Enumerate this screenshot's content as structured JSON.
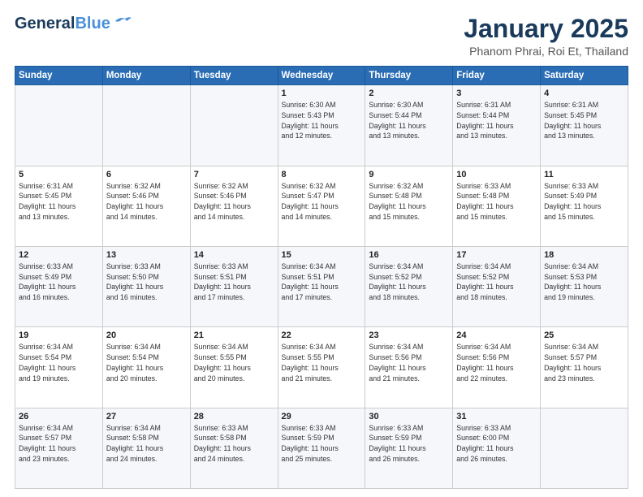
{
  "header": {
    "logo_general": "General",
    "logo_blue": "Blue",
    "month_title": "January 2025",
    "location": "Phanom Phrai, Roi Et, Thailand"
  },
  "days_of_week": [
    "Sunday",
    "Monday",
    "Tuesday",
    "Wednesday",
    "Thursday",
    "Friday",
    "Saturday"
  ],
  "weeks": [
    [
      {
        "day": "",
        "info": ""
      },
      {
        "day": "",
        "info": ""
      },
      {
        "day": "",
        "info": ""
      },
      {
        "day": "1",
        "info": "Sunrise: 6:30 AM\nSunset: 5:43 PM\nDaylight: 11 hours\nand 12 minutes."
      },
      {
        "day": "2",
        "info": "Sunrise: 6:30 AM\nSunset: 5:44 PM\nDaylight: 11 hours\nand 13 minutes."
      },
      {
        "day": "3",
        "info": "Sunrise: 6:31 AM\nSunset: 5:44 PM\nDaylight: 11 hours\nand 13 minutes."
      },
      {
        "day": "4",
        "info": "Sunrise: 6:31 AM\nSunset: 5:45 PM\nDaylight: 11 hours\nand 13 minutes."
      }
    ],
    [
      {
        "day": "5",
        "info": "Sunrise: 6:31 AM\nSunset: 5:45 PM\nDaylight: 11 hours\nand 13 minutes."
      },
      {
        "day": "6",
        "info": "Sunrise: 6:32 AM\nSunset: 5:46 PM\nDaylight: 11 hours\nand 14 minutes."
      },
      {
        "day": "7",
        "info": "Sunrise: 6:32 AM\nSunset: 5:46 PM\nDaylight: 11 hours\nand 14 minutes."
      },
      {
        "day": "8",
        "info": "Sunrise: 6:32 AM\nSunset: 5:47 PM\nDaylight: 11 hours\nand 14 minutes."
      },
      {
        "day": "9",
        "info": "Sunrise: 6:32 AM\nSunset: 5:48 PM\nDaylight: 11 hours\nand 15 minutes."
      },
      {
        "day": "10",
        "info": "Sunrise: 6:33 AM\nSunset: 5:48 PM\nDaylight: 11 hours\nand 15 minutes."
      },
      {
        "day": "11",
        "info": "Sunrise: 6:33 AM\nSunset: 5:49 PM\nDaylight: 11 hours\nand 15 minutes."
      }
    ],
    [
      {
        "day": "12",
        "info": "Sunrise: 6:33 AM\nSunset: 5:49 PM\nDaylight: 11 hours\nand 16 minutes."
      },
      {
        "day": "13",
        "info": "Sunrise: 6:33 AM\nSunset: 5:50 PM\nDaylight: 11 hours\nand 16 minutes."
      },
      {
        "day": "14",
        "info": "Sunrise: 6:33 AM\nSunset: 5:51 PM\nDaylight: 11 hours\nand 17 minutes."
      },
      {
        "day": "15",
        "info": "Sunrise: 6:34 AM\nSunset: 5:51 PM\nDaylight: 11 hours\nand 17 minutes."
      },
      {
        "day": "16",
        "info": "Sunrise: 6:34 AM\nSunset: 5:52 PM\nDaylight: 11 hours\nand 18 minutes."
      },
      {
        "day": "17",
        "info": "Sunrise: 6:34 AM\nSunset: 5:52 PM\nDaylight: 11 hours\nand 18 minutes."
      },
      {
        "day": "18",
        "info": "Sunrise: 6:34 AM\nSunset: 5:53 PM\nDaylight: 11 hours\nand 19 minutes."
      }
    ],
    [
      {
        "day": "19",
        "info": "Sunrise: 6:34 AM\nSunset: 5:54 PM\nDaylight: 11 hours\nand 19 minutes."
      },
      {
        "day": "20",
        "info": "Sunrise: 6:34 AM\nSunset: 5:54 PM\nDaylight: 11 hours\nand 20 minutes."
      },
      {
        "day": "21",
        "info": "Sunrise: 6:34 AM\nSunset: 5:55 PM\nDaylight: 11 hours\nand 20 minutes."
      },
      {
        "day": "22",
        "info": "Sunrise: 6:34 AM\nSunset: 5:55 PM\nDaylight: 11 hours\nand 21 minutes."
      },
      {
        "day": "23",
        "info": "Sunrise: 6:34 AM\nSunset: 5:56 PM\nDaylight: 11 hours\nand 21 minutes."
      },
      {
        "day": "24",
        "info": "Sunrise: 6:34 AM\nSunset: 5:56 PM\nDaylight: 11 hours\nand 22 minutes."
      },
      {
        "day": "25",
        "info": "Sunrise: 6:34 AM\nSunset: 5:57 PM\nDaylight: 11 hours\nand 23 minutes."
      }
    ],
    [
      {
        "day": "26",
        "info": "Sunrise: 6:34 AM\nSunset: 5:57 PM\nDaylight: 11 hours\nand 23 minutes."
      },
      {
        "day": "27",
        "info": "Sunrise: 6:34 AM\nSunset: 5:58 PM\nDaylight: 11 hours\nand 24 minutes."
      },
      {
        "day": "28",
        "info": "Sunrise: 6:33 AM\nSunset: 5:58 PM\nDaylight: 11 hours\nand 24 minutes."
      },
      {
        "day": "29",
        "info": "Sunrise: 6:33 AM\nSunset: 5:59 PM\nDaylight: 11 hours\nand 25 minutes."
      },
      {
        "day": "30",
        "info": "Sunrise: 6:33 AM\nSunset: 5:59 PM\nDaylight: 11 hours\nand 26 minutes."
      },
      {
        "day": "31",
        "info": "Sunrise: 6:33 AM\nSunset: 6:00 PM\nDaylight: 11 hours\nand 26 minutes."
      },
      {
        "day": "",
        "info": ""
      }
    ]
  ]
}
